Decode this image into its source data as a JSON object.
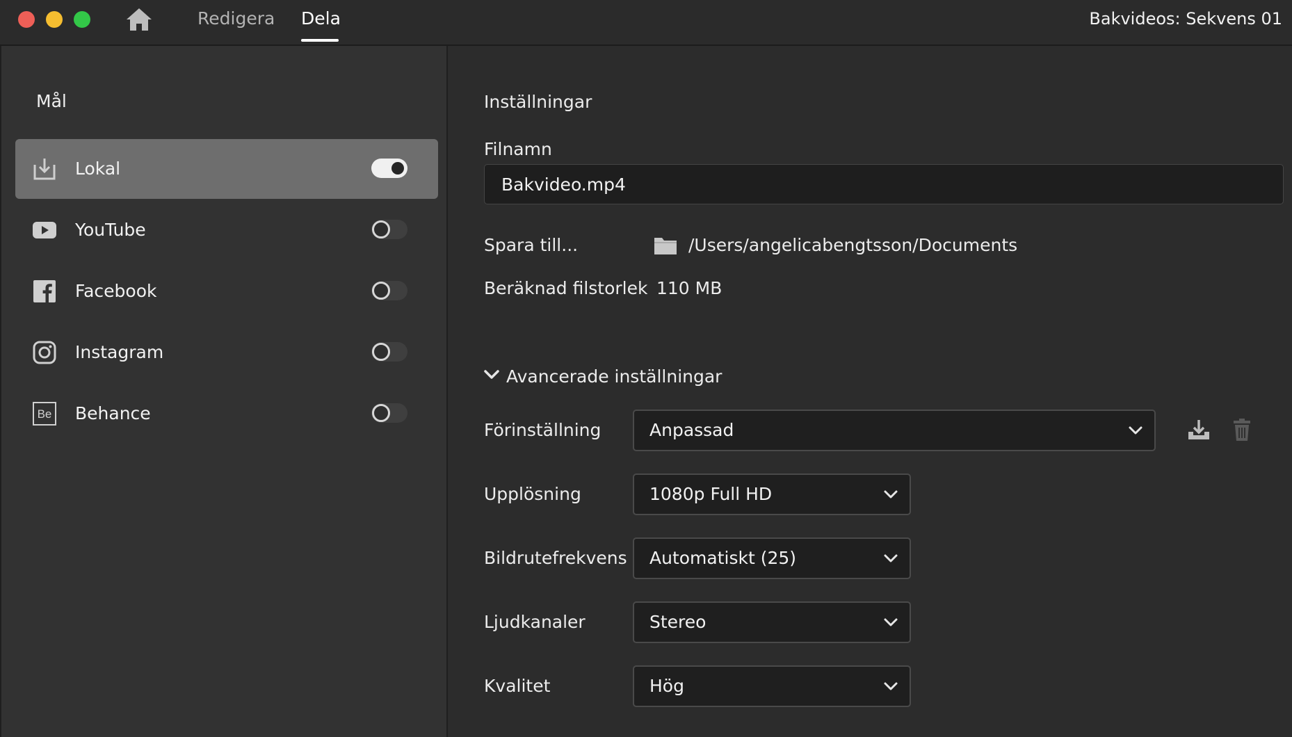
{
  "window": {
    "controls": [
      "close",
      "minimize",
      "maximize"
    ],
    "home_icon": "home-icon",
    "tabs": [
      {
        "label": "Redigera",
        "active": false
      },
      {
        "label": "Dela",
        "active": true
      }
    ],
    "project_title": "Bakvideos: Sekvens 01"
  },
  "sidebar": {
    "heading": "Mål",
    "destinations": [
      {
        "label": "Lokal",
        "icon": "download-icon",
        "enabled": true,
        "selected": true
      },
      {
        "label": "YouTube",
        "icon": "youtube-icon",
        "enabled": false,
        "selected": false
      },
      {
        "label": "Facebook",
        "icon": "facebook-icon",
        "enabled": false,
        "selected": false
      },
      {
        "label": "Instagram",
        "icon": "instagram-icon",
        "enabled": false,
        "selected": false
      },
      {
        "label": "Behance",
        "icon": "behance-icon",
        "enabled": false,
        "selected": false,
        "icon_text": "Be"
      }
    ]
  },
  "settings": {
    "heading": "Inställningar",
    "filename_label": "Filnamn",
    "filename_value": "Bakvideo.mp4",
    "save_to_label": "Spara till...",
    "save_to_path": "/Users/angelicabengtsson/Documents",
    "filesize_label": "Beräknad filstorlek",
    "filesize_value": "110 MB",
    "advanced_label": "Avancerade inställningar",
    "advanced_expanded": true,
    "preset": {
      "label": "Förinställning",
      "value": "Anpassad"
    },
    "resolution": {
      "label": "Upplösning",
      "value": "1080p Full HD"
    },
    "framerate": {
      "label": "Bildrutefrekvens",
      "value": "Automatiskt (25)"
    },
    "audio": {
      "label": "Ljudkanaler",
      "value": "Stereo"
    },
    "quality": {
      "label": "Kvalitet",
      "value": "Hög"
    }
  },
  "colors": {
    "background": "#2c2c2c",
    "sidebar": "#323232",
    "selected_row": "#6e6e6e",
    "input_bg": "#1e1e1e",
    "close": "#ee5f57",
    "minimize": "#f5bd30",
    "maximize": "#33c748"
  }
}
